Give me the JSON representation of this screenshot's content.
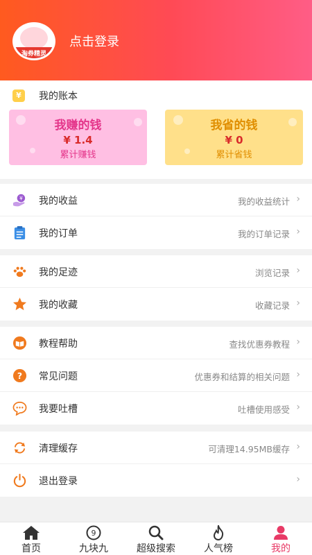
{
  "header": {
    "login_text": "点击登录",
    "logo_text": "淘券精灵"
  },
  "account": {
    "title": "我的账本",
    "icon_glyph": "¥",
    "earn": {
      "title": "我赚的钱",
      "amount": "¥ 1.4",
      "sub": "累计赚钱"
    },
    "save": {
      "title": "我省的钱",
      "amount": "¥ 0",
      "sub": "累计省钱"
    }
  },
  "groups": [
    [
      {
        "icon": "income-icon",
        "label": "我的收益",
        "value": "我的收益统计"
      },
      {
        "icon": "order-icon",
        "label": "我的订单",
        "value": "我的订单记录"
      }
    ],
    [
      {
        "icon": "footprint-icon",
        "label": "我的足迹",
        "value": "浏览记录"
      },
      {
        "icon": "star-icon",
        "label": "我的收藏",
        "value": "收藏记录"
      }
    ],
    [
      {
        "icon": "tutorial-icon",
        "label": "教程帮助",
        "value": "查找优惠券教程"
      },
      {
        "icon": "question-icon",
        "label": "常见问题",
        "value": "优惠券和结算的相关问题"
      },
      {
        "icon": "feedback-icon",
        "label": "我要吐槽",
        "value": "吐槽使用感受"
      }
    ],
    [
      {
        "icon": "refresh-icon",
        "label": "清理缓存",
        "value": "可清理14.95MB缓存"
      },
      {
        "icon": "power-icon",
        "label": "退出登录",
        "value": ""
      }
    ]
  ],
  "chevron": "›",
  "tabs": [
    {
      "icon": "home-icon",
      "label": "首页",
      "active": false
    },
    {
      "icon": "nine-icon",
      "label": "九块九",
      "active": false,
      "badge": "9"
    },
    {
      "icon": "search-icon",
      "label": "超级搜索",
      "active": false
    },
    {
      "icon": "fire-icon",
      "label": "人气榜",
      "active": false
    },
    {
      "icon": "user-icon",
      "label": "我的",
      "active": true
    }
  ],
  "colors": {
    "accent": "#e83a66",
    "header_start": "#ff5a1f",
    "header_end": "#ff5d86",
    "icon_orange": "#f07a1e"
  }
}
